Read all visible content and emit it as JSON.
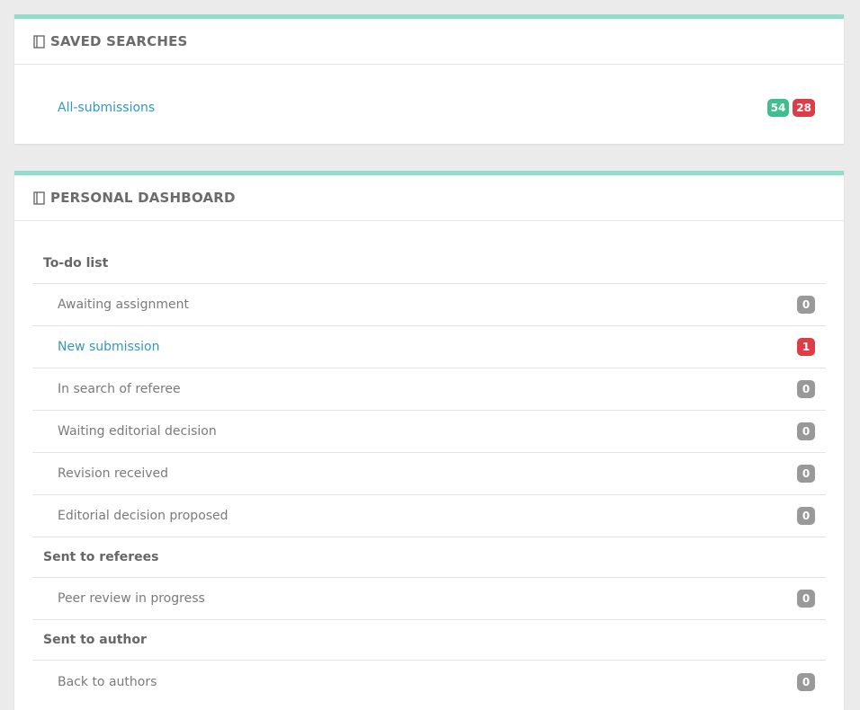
{
  "saved_searches": {
    "title": "SAVED SEARCHES",
    "icon": "book-icon",
    "items": [
      {
        "label": "All-submissions",
        "count_a": "54",
        "count_b": "28"
      }
    ]
  },
  "dashboard": {
    "title": "PERSONAL DASHBOARD",
    "icon": "book-icon",
    "sections": [
      {
        "heading": "To-do list",
        "items": [
          {
            "label": "Awaiting assignment",
            "count": "0"
          },
          {
            "label": "New submission",
            "count": "1"
          },
          {
            "label": "In search of referee",
            "count": "0"
          },
          {
            "label": "Waiting editorial decision",
            "count": "0"
          },
          {
            "label": "Revision received",
            "count": "0"
          },
          {
            "label": "Editorial decision proposed",
            "count": "0"
          }
        ]
      },
      {
        "heading": "Sent to referees",
        "items": [
          {
            "label": "Peer review in progress",
            "count": "0"
          }
        ]
      },
      {
        "heading": "Sent to author",
        "items": [
          {
            "label": "Back to authors",
            "count": "0"
          }
        ]
      }
    ]
  },
  "colors": {
    "accent_border": "#93dcc9",
    "link": "#3297c4",
    "badge_green": "#3fbf91",
    "badge_red": "#dd3d46",
    "badge_gray": "#999999"
  }
}
